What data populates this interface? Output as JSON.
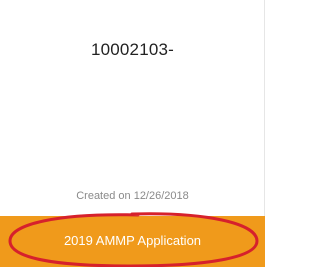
{
  "card": {
    "id_text": "10002103-",
    "created_text": "Created on 12/26/2018",
    "footer_label": "2019 AMMP Application"
  },
  "colors": {
    "footer_background": "#f09a1b",
    "annotation": "#d6212c"
  }
}
